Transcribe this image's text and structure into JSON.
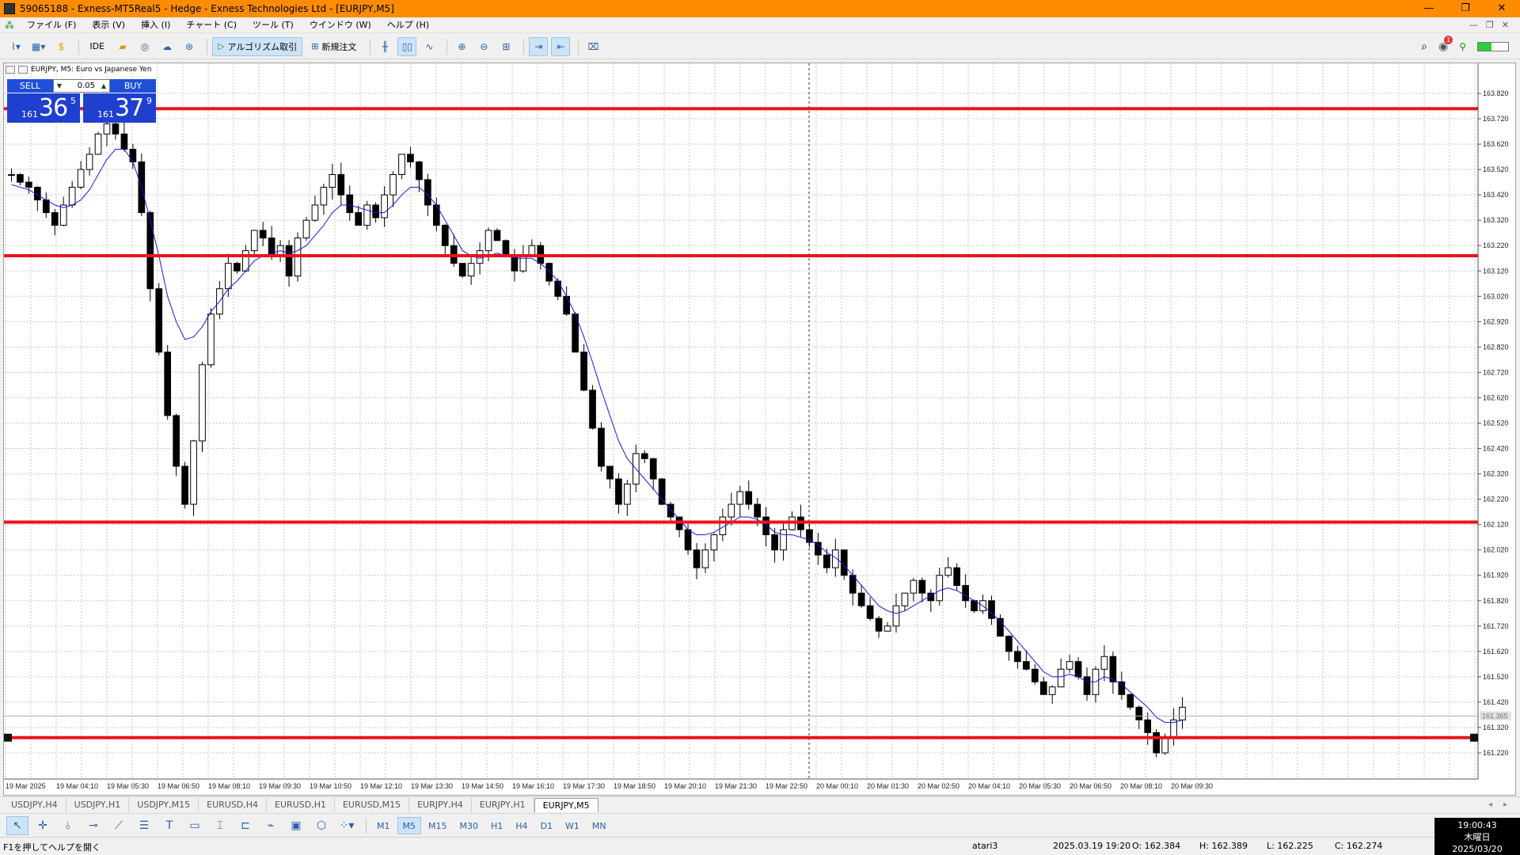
{
  "window": {
    "title": "59065188 - Exness-MT5Real5 - Hedge - Exness Technologies Ltd - [EURJPY,M5]",
    "controls": [
      "—",
      "❐",
      "✕"
    ]
  },
  "menu": {
    "items": [
      "ファイル (F)",
      "表示 (V)",
      "挿入 (I)",
      "チャート (C)",
      "ツール (T)",
      "ウインドウ (W)",
      "ヘルプ (H)"
    ],
    "right_controls": [
      "—",
      "❐",
      "✕"
    ]
  },
  "toolbar": {
    "ide_label": "IDE",
    "algo_label": "アルゴリズム取引",
    "new_order_label": "新規注文",
    "notification_count": "1",
    "signal_level": 0.45
  },
  "chart": {
    "symbol_label": "EURJPY, M5:  Euro vs Japanese Yen",
    "sell_label": "SELL",
    "buy_label": "BUY",
    "volume": "0.05",
    "bid_small": "161",
    "bid_big": "36",
    "bid_sup": "5",
    "ask_small": "161",
    "ask_big": "37",
    "ask_sup": "9",
    "current_price_label": "161.365",
    "colors": {
      "horizontal_line": "#e8141b",
      "ma_line": "#1a1adc",
      "candle": "#000000",
      "grid": "#c8c8c8"
    }
  },
  "chart_data": {
    "type": "candlestick",
    "symbol": "EURJPY",
    "timeframe": "M5",
    "ylim": [
      161.15,
      163.82
    ],
    "y_ticks": [
      "163.820",
      "163.720",
      "163.620",
      "163.520",
      "163.420",
      "163.320",
      "163.220",
      "163.120",
      "163.020",
      "162.920",
      "162.820",
      "162.720",
      "162.620",
      "162.520",
      "162.420",
      "162.320",
      "162.220",
      "162.120",
      "162.020",
      "161.920",
      "161.820",
      "161.720",
      "161.620",
      "161.520",
      "161.420",
      "161.320",
      "161.220"
    ],
    "x_ticks": [
      "19 Mar 2025",
      "19 Mar 04:10",
      "19 Mar 05:30",
      "19 Mar 06:50",
      "19 Mar 08:10",
      "19 Mar 09:30",
      "19 Mar 10:50",
      "19 Mar 12:10",
      "19 Mar 13:30",
      "19 Mar 14:50",
      "19 Mar 16:10",
      "19 Mar 17:30",
      "19 Mar 18:50",
      "19 Mar 20:10",
      "19 Mar 21:30",
      "19 Mar 22:50",
      "20 Mar 00:10",
      "20 Mar 01:30",
      "20 Mar 02:50",
      "20 Mar 04:10",
      "20 Mar 05:30",
      "20 Mar 06:50",
      "20 Mar 08:10",
      "20 Mar 09:30"
    ],
    "horizontal_lines": [
      163.76,
      163.18,
      162.13,
      161.28
    ],
    "price_path": [
      163.5,
      163.47,
      163.45,
      163.4,
      163.35,
      163.3,
      163.38,
      163.45,
      163.52,
      163.58,
      163.66,
      163.7,
      163.66,
      163.6,
      163.55,
      163.35,
      163.05,
      162.8,
      162.55,
      162.35,
      162.2,
      162.45,
      162.75,
      162.95,
      163.05,
      163.15,
      163.12,
      163.2,
      163.28,
      163.25,
      163.18,
      163.22,
      163.1,
      163.25,
      163.32,
      163.38,
      163.45,
      163.5,
      163.42,
      163.35,
      163.3,
      163.38,
      163.33,
      163.42,
      163.5,
      163.58,
      163.55,
      163.48,
      163.38,
      163.3,
      163.22,
      163.15,
      163.1,
      163.15,
      163.2,
      163.28,
      163.24,
      163.18,
      163.12,
      163.18,
      163.22,
      163.15,
      163.08,
      163.02,
      162.95,
      162.8,
      162.65,
      162.5,
      162.35,
      162.3,
      162.2,
      162.28,
      162.4,
      162.38,
      162.3,
      162.2,
      162.15,
      162.1,
      162.02,
      161.95,
      162.02,
      162.08,
      162.15,
      162.2,
      162.25,
      162.2,
      162.15,
      162.08,
      162.02,
      162.1,
      162.15,
      162.1,
      162.05,
      162.0,
      161.95,
      162.02,
      161.92,
      161.85,
      161.8,
      161.75,
      161.7,
      161.72,
      161.8,
      161.85,
      161.9,
      161.85,
      161.82,
      161.92,
      161.95,
      161.88,
      161.82,
      161.78,
      161.82,
      161.75,
      161.68,
      161.62,
      161.58,
      161.55,
      161.5,
      161.45,
      161.48,
      161.55,
      161.58,
      161.52,
      161.45,
      161.55,
      161.6,
      161.5,
      161.45,
      161.4,
      161.35,
      161.3,
      161.22,
      161.28,
      161.35,
      161.4
    ],
    "ma_path": [
      163.46,
      163.45,
      163.44,
      163.42,
      163.4,
      163.38,
      163.37,
      163.38,
      163.4,
      163.44,
      163.5,
      163.56,
      163.6,
      163.6,
      163.55,
      163.45,
      163.32,
      163.18,
      163.02,
      162.92,
      162.85,
      162.86,
      162.9,
      162.96,
      163.0,
      163.05,
      163.08,
      163.12,
      163.16,
      163.18,
      163.19,
      163.2,
      163.19,
      163.2,
      163.22,
      163.26,
      163.3,
      163.35,
      163.38,
      163.38,
      163.37,
      163.36,
      163.35,
      163.35,
      163.38,
      163.42,
      163.45,
      163.45,
      163.42,
      163.38,
      163.32,
      163.26,
      163.2,
      163.18,
      163.17,
      163.18,
      163.19,
      163.18,
      163.17,
      163.17,
      163.17,
      163.15,
      163.12,
      163.08,
      163.02,
      162.95,
      162.86,
      162.76,
      162.65,
      162.55,
      162.45,
      162.38,
      162.34,
      162.3,
      162.26,
      162.22,
      162.18,
      162.14,
      162.1,
      162.08,
      162.08,
      162.09,
      162.11,
      162.13,
      162.15,
      162.15,
      162.14,
      162.12,
      162.09,
      162.08,
      162.08,
      162.07,
      162.06,
      162.04,
      162.01,
      161.99,
      161.96,
      161.92,
      161.88,
      161.84,
      161.8,
      161.78,
      161.77,
      161.78,
      161.8,
      161.82,
      161.84,
      161.86,
      161.87,
      161.86,
      161.84,
      161.82,
      161.8,
      161.77,
      161.74,
      161.7,
      161.66,
      161.62,
      161.58,
      161.54,
      161.52,
      161.52,
      161.53,
      161.52,
      161.5,
      161.5,
      161.52,
      161.51,
      161.49,
      161.46,
      161.43,
      161.4,
      161.36,
      161.34,
      161.34,
      161.35
    ]
  },
  "symbol_tabs": {
    "items": [
      "USDJPY,H4",
      "USDJPY,H1",
      "USDJPY,M15",
      "EURUSD,H4",
      "EURUSD,H1",
      "EURUSD,M15",
      "EURJPY,H4",
      "EURJPY,H1",
      "EURJPY,M5"
    ],
    "active_index": 8,
    "nav": [
      "◂",
      "▸"
    ]
  },
  "timeframes": {
    "items": [
      "M1",
      "M5",
      "M15",
      "M30",
      "H1",
      "H4",
      "D1",
      "W1",
      "MN"
    ],
    "active_index": 1
  },
  "status": {
    "help_text": "F1を押してヘルプを開く",
    "profile": "atari3",
    "datetime": "2025.03.19 19:20",
    "open": "O: 162.384",
    "high": "H: 162.389",
    "low": "L: 162.225",
    "close": "C: 162.274"
  },
  "clock": {
    "time": "19:00:43",
    "day": "木曜日",
    "date": "2025/03/20"
  }
}
